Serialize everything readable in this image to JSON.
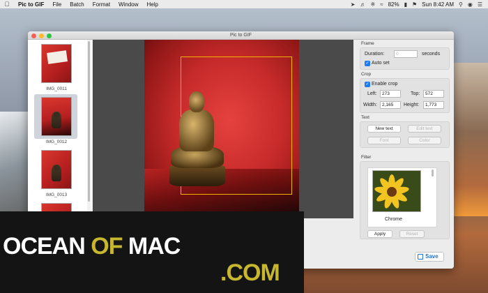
{
  "menubar": {
    "app_name": "Pic to GIF",
    "items": [
      "File",
      "Batch",
      "Format",
      "Window",
      "Help"
    ],
    "battery": "82%",
    "clock": "Sun 8:42 AM"
  },
  "window": {
    "title": "Pic to GIF"
  },
  "thumbnails": [
    {
      "label": "IMG_0011"
    },
    {
      "label": "IMG_0012"
    },
    {
      "label": "IMG_0013"
    }
  ],
  "panel": {
    "frame": {
      "title": "Frame",
      "duration_label": "Duration:",
      "duration_value": "0",
      "unit": "seconds",
      "auto_set": "Auto set"
    },
    "crop": {
      "title": "Crop",
      "enable": "Enable crop",
      "left_label": "Left:",
      "left_value": "273",
      "top_label": "Top:",
      "top_value": "572",
      "width_label": "Width:",
      "width_value": "2,165",
      "height_label": "Height:",
      "height_value": "1,773"
    },
    "text": {
      "title": "Text",
      "new_text": "New text",
      "edit_text": "Edit text",
      "font": "Font",
      "color": "Color"
    },
    "filter": {
      "title": "Filter",
      "name": "Chrome",
      "apply": "Apply",
      "reset": "Reset"
    },
    "save": "Save"
  },
  "watermark": {
    "ocean": "OCEAN",
    "of": "OF",
    "mac": "MAC",
    "com": ".COM"
  }
}
